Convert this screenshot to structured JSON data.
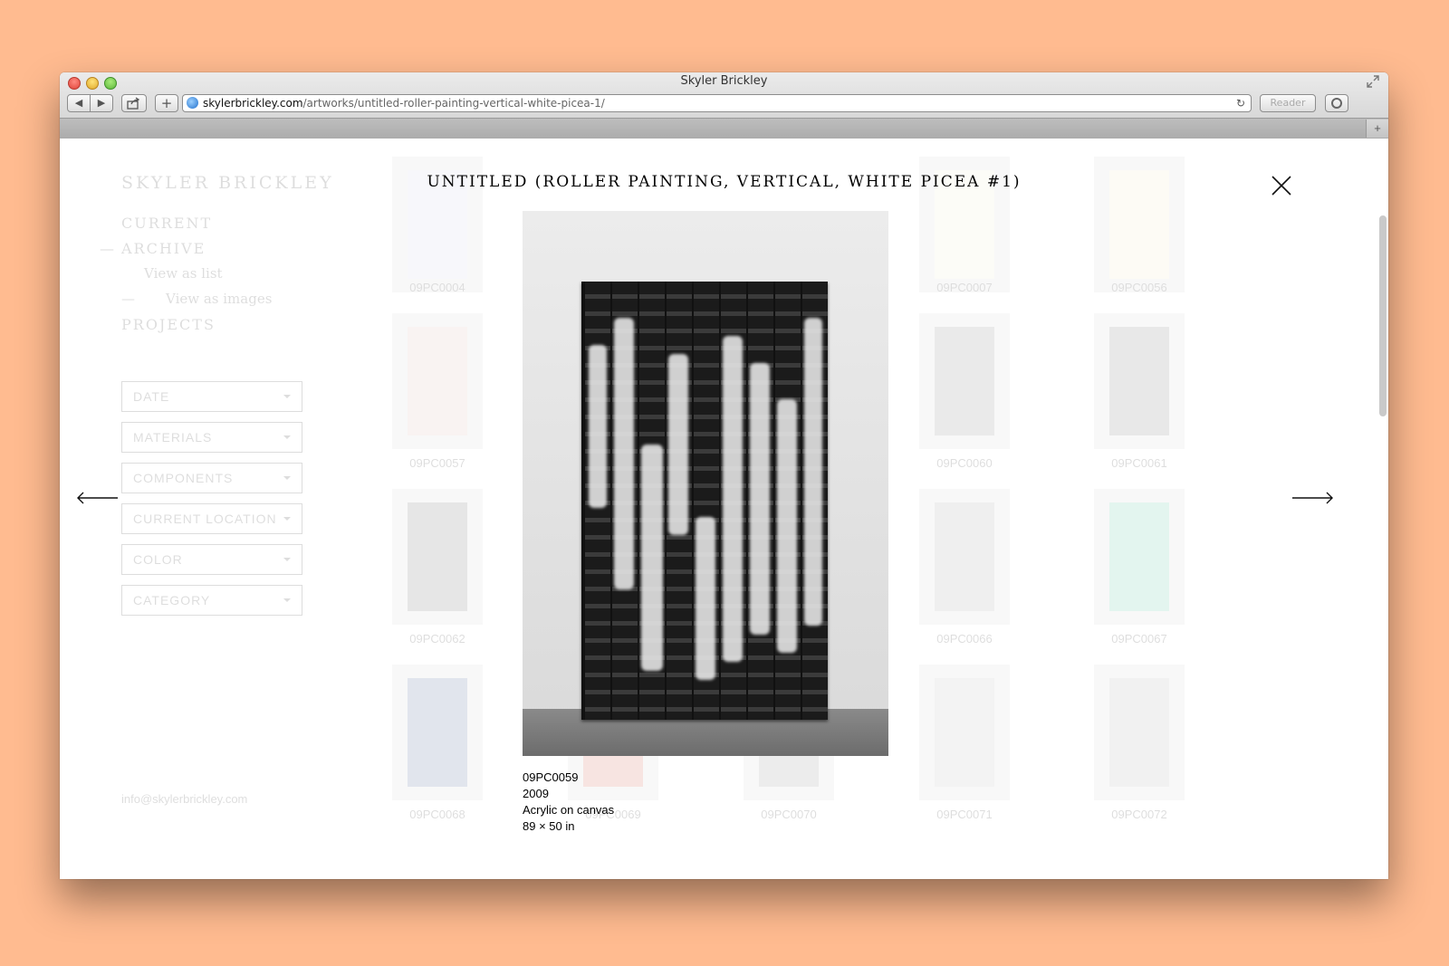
{
  "browser": {
    "window_title": "Skyler Brickley",
    "url_domain": "skylerbrickley.com",
    "url_path": "/artworks/untitled-roller-painting-vertical-white-picea-1/",
    "reader_label": "Reader",
    "back_glyph": "◀",
    "forward_glyph": "▶",
    "add_glyph": "+",
    "reload_glyph": "↻",
    "newtab_glyph": "+"
  },
  "site": {
    "logo": "SKYLER BRICKLEY",
    "nav": {
      "current": "CURRENT",
      "archive": "ARCHIVE",
      "view_list": "View as list",
      "view_images": "View as images",
      "projects": "PROJECTS",
      "dash": "—"
    },
    "filters": [
      "DATE",
      "MATERIALS",
      "COMPONENTS",
      "CURRENT LOCATION",
      "COLOR",
      "CATEGORY"
    ],
    "email": "info@skylerbrickley.com"
  },
  "grid": [
    {
      "label": "09PC0004",
      "color": "#c9c6e6"
    },
    {
      "label": "09PC0007",
      "color": "#efe9c4"
    },
    {
      "label": "09PC0056",
      "color": "#f1e7b9"
    },
    {
      "label": "09PC0057",
      "color": "#d8a7a2"
    },
    {
      "label": "09PC0060",
      "color": "#666666"
    },
    {
      "label": "09PC0061",
      "color": "#555555"
    },
    {
      "label": "09PC0062",
      "color": "#444444"
    },
    {
      "label": "09PC0066",
      "color": "#888888"
    },
    {
      "label": "09PC0067",
      "color": "#2fb889"
    },
    {
      "label": "09PC0068",
      "color": "#24407a"
    },
    {
      "label": "09PC0069",
      "color": "#c93a1f"
    },
    {
      "label": "09PC0070",
      "color": "#777777"
    },
    {
      "label": "09PC0071",
      "color": "#aaaaaa"
    },
    {
      "label": "09PC0072",
      "color": "#999999"
    }
  ],
  "modal": {
    "title": "UNTITLED (ROLLER PAINTING, VERTICAL, WHITE PICEA #1)",
    "catalog_number": "09PC0059",
    "year": "2009",
    "medium": "Acrylic on canvas",
    "dimensions": "89 × 50 in"
  }
}
